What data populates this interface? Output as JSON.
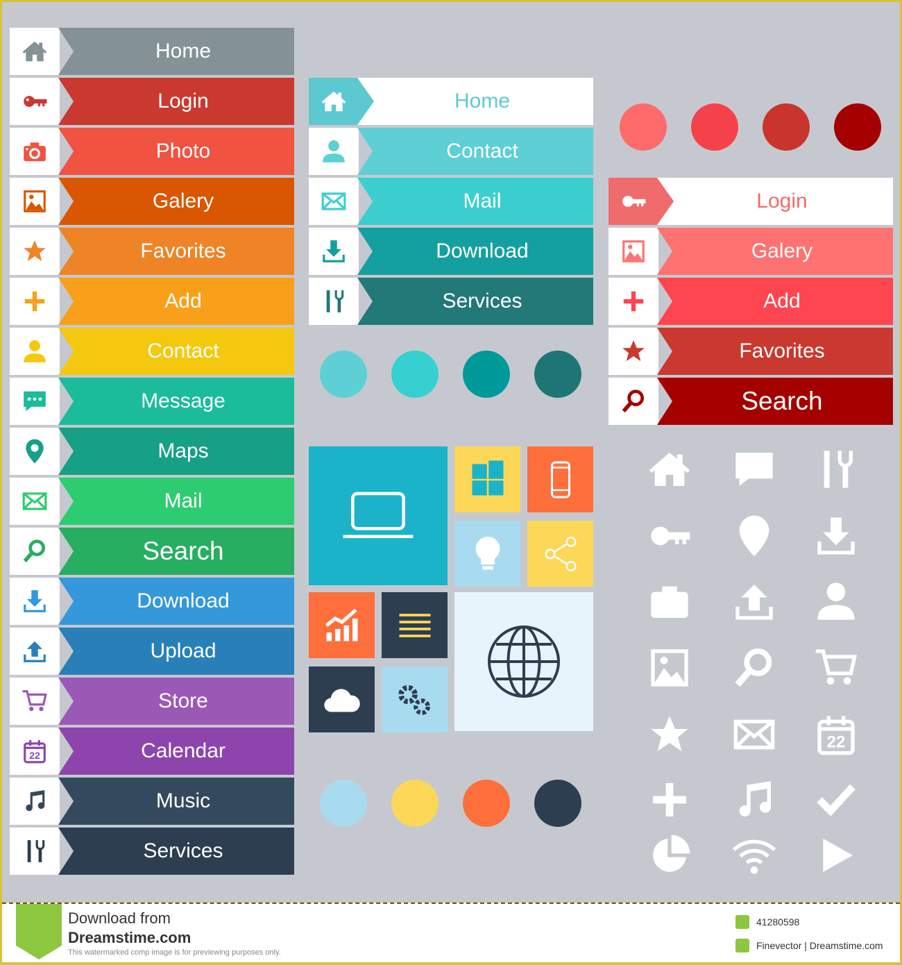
{
  "left_menu": [
    {
      "label": "Home",
      "icon": "home",
      "color": "#849296"
    },
    {
      "label": "Login",
      "icon": "key",
      "color": "#c9392f"
    },
    {
      "label": "Photo",
      "icon": "camera",
      "color": "#f05340"
    },
    {
      "label": "Galery",
      "icon": "image",
      "color": "#d95700"
    },
    {
      "label": "Favorites",
      "icon": "star",
      "color": "#ee8426"
    },
    {
      "label": "Add",
      "icon": "plus",
      "color": "#f9a01b"
    },
    {
      "label": "Contact",
      "icon": "user",
      "color": "#f5c810"
    },
    {
      "label": "Message",
      "icon": "message",
      "color": "#1abc9c"
    },
    {
      "label": "Maps",
      "icon": "map-pin",
      "color": "#16a085"
    },
    {
      "label": "Mail",
      "icon": "mail",
      "color": "#2ecc71"
    },
    {
      "label": "Search",
      "icon": "search",
      "color": "#27ae60"
    },
    {
      "label": "Download",
      "icon": "download",
      "color": "#3498db"
    },
    {
      "label": "Upload",
      "icon": "upload",
      "color": "#2980b9"
    },
    {
      "label": "Store",
      "icon": "cart",
      "color": "#9b59b6"
    },
    {
      "label": "Calendar",
      "icon": "calendar",
      "color": "#8e44ad"
    },
    {
      "label": "Music",
      "icon": "music",
      "color": "#34495e"
    },
    {
      "label": "Services",
      "icon": "tools",
      "color": "#2c3e50"
    }
  ],
  "middle_menu": [
    {
      "label": "Home",
      "icon": "home",
      "color": "#5cc9d0",
      "active": true
    },
    {
      "label": "Contact",
      "icon": "user",
      "color": "#5ecfd4"
    },
    {
      "label": "Mail",
      "icon": "mail",
      "color": "#3ccfcf"
    },
    {
      "label": "Download",
      "icon": "download",
      "color": "#14a0a0"
    },
    {
      "label": "Services",
      "icon": "tools",
      "color": "#237878"
    }
  ],
  "right_menu": [
    {
      "label": "Login",
      "icon": "key",
      "color": "#f06b6b",
      "active": true
    },
    {
      "label": "Galery",
      "icon": "image",
      "color": "#ff7272"
    },
    {
      "label": "Add",
      "icon": "plus",
      "color": "#ff4550"
    },
    {
      "label": "Favorites",
      "icon": "star",
      "color": "#c9392f"
    },
    {
      "label": "Search",
      "icon": "search",
      "color": "#a50000"
    }
  ],
  "swatches": {
    "red": [
      "#ff6b6b",
      "#f5424a",
      "#c9342d",
      "#a50000"
    ],
    "teal": [
      "#5ecfd4",
      "#36d0d0",
      "#009a9a",
      "#1f7575"
    ],
    "tile": [
      "#a8dbf0",
      "#fcd758",
      "#ff6f3c",
      "#2c3e50"
    ]
  },
  "tiles": [
    {
      "icon": "laptop",
      "bg": "#1ab3c9",
      "fg": "#ffffff"
    },
    {
      "icon": "windows",
      "bg": "#fcd758",
      "fg": "#1ab3c9"
    },
    {
      "icon": "phone",
      "bg": "#ff6f3c",
      "fg": "#ffffff"
    },
    {
      "icon": "bulb",
      "bg": "#a8dbf0",
      "fg": "#ffffff"
    },
    {
      "icon": "share",
      "bg": "#fcd758",
      "fg": "#ffffff"
    },
    {
      "icon": "chart",
      "bg": "#ff6f3c",
      "fg": "#ffffff"
    },
    {
      "icon": "lines",
      "bg": "#2c3e50",
      "fg": "#fcd758"
    },
    {
      "icon": "globe",
      "bg": "#e8f4fb",
      "fg": "#2c3e50"
    },
    {
      "icon": "cloud",
      "bg": "#2c3e50",
      "fg": "#ffffff"
    },
    {
      "icon": "gears",
      "bg": "#a8dbf0",
      "fg": "#2c3e50"
    }
  ],
  "icon_grid": [
    "home",
    "message",
    "tools",
    "key",
    "map-pin",
    "download",
    "camera",
    "upload",
    "user",
    "image",
    "search",
    "cart",
    "star",
    "mail",
    "calendar",
    "plus",
    "music",
    "check",
    "pie",
    "wifi",
    "play"
  ],
  "banner": {
    "line1": "Download from",
    "line2": "Dreamstime.com",
    "note": "This watermarked comp image is for previewing purposes only.",
    "id": "41280598",
    "author": "Finevector | Dreamstime.com",
    "accent": "#8dc63f"
  }
}
